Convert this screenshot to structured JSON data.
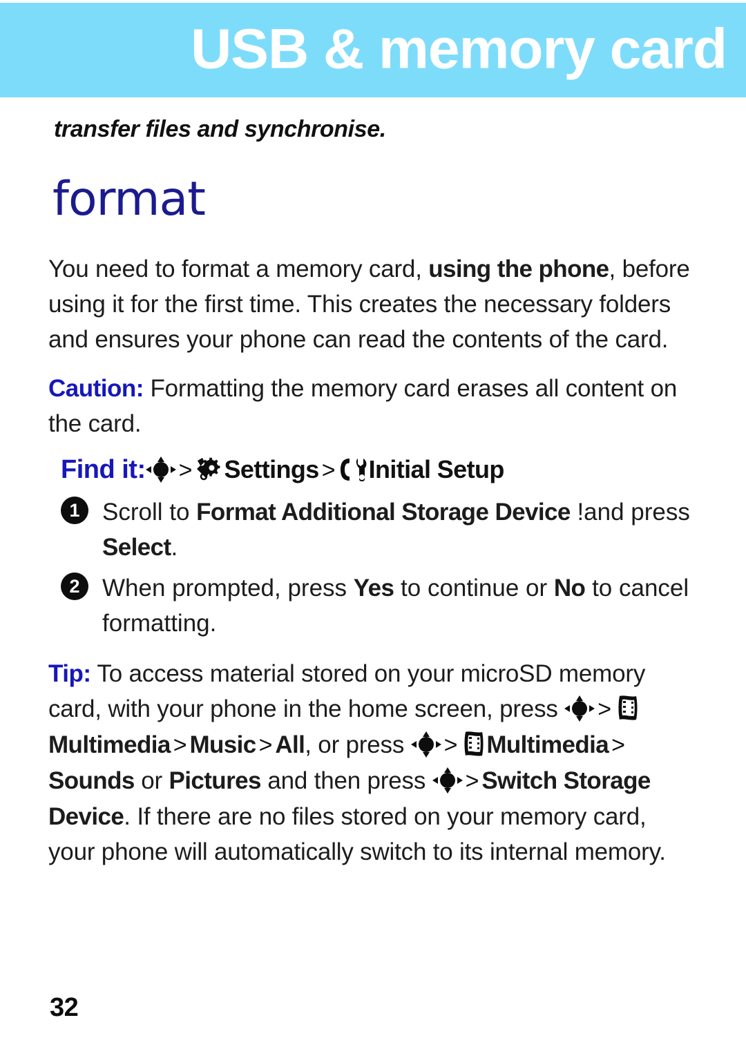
{
  "header": {
    "title": "USB & memory card",
    "banner_color": "#7edcfb",
    "title_color": "#ffffff"
  },
  "subtitle": "transfer files and synchronise.",
  "section": {
    "heading": "format",
    "heading_color": "#1b1b8f"
  },
  "intro": {
    "part1": "You need to format a memory card, ",
    "bold1": "using the phone",
    "part2": ", before using it for the first time. This creates the necessary folders and ensures your phone can read the contents of the card."
  },
  "caution": {
    "label": "Caution:",
    "label_color": "#1717ba",
    "text": " Formatting the memory card erases all content on the card."
  },
  "find_it": {
    "label": "Find it:",
    "label_color": "#1717ba",
    "separator": ">",
    "nav_icon": "dpad-navigation-icon",
    "settings_icon": "settings-wrench-gear-icon",
    "settings_label": "Settings",
    "initial_setup_icon": "initial-setup-phone-wrench-icon",
    "initial_setup_label": "Initial Setup"
  },
  "steps": [
    {
      "number": "1",
      "pre": "Scroll to ",
      "bold": "Format Additional Storage Device",
      "mid": " !and press ",
      "bold2": "Select",
      "post": "."
    },
    {
      "number": "2",
      "pre": "When prompted, press ",
      "bold": "Yes",
      "mid": " to continue or ",
      "bold2": "No",
      "post": " to cancel formatting."
    }
  ],
  "tip": {
    "label": "Tip:",
    "label_color": "#1717ba",
    "t1": " To access material stored on your microSD memory card, with your phone in the home screen, press ",
    "sep1": ">",
    "media_icon": "multimedia-filmstrip-icon",
    "b_multimedia": "Multimedia",
    "sep2": ">",
    "b_music": "Music",
    "sep3": ">",
    "b_all": "All",
    "t2": ", or press ",
    "sep4": ">",
    "b_multimedia2": "Multimedia",
    "sep5": ">",
    "b_sounds": "Sounds",
    "t3": " or ",
    "b_pictures": "Pictures",
    "t4": " and then press ",
    "sep6": ">",
    "b_switch": "Switch Storage Device",
    "t5": ". If there are no files stored on your memory card, your phone will automatically switch to its internal memory."
  },
  "page_number": "32"
}
